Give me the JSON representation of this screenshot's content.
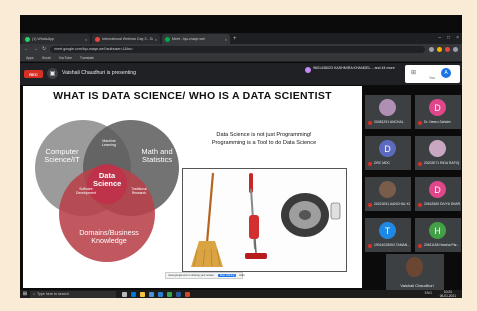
{
  "browser": {
    "tabs": [
      {
        "label": "(1) WhatsApp",
        "icon": "whatsapp-icon",
        "color": "#25d366"
      },
      {
        "label": "International Webinar Day 3 - Sc",
        "icon": "webinar-icon",
        "color": "#e8453c"
      },
      {
        "label": "Meet - fqu-maqe-wei",
        "icon": "meet-icon",
        "color": "#00ac47"
      }
    ],
    "url": "meet.google.com/fqu-maqe-wei?authuser=1&hs=",
    "bookmarks": [
      "Apps",
      "Gmail",
      "YouTube",
      "Translate"
    ]
  },
  "meet": {
    "rec_label": "REC",
    "presenting_text": "Vaishali Chaudhuri is presenting",
    "join_note": "9601436023 KASHMIRA KHANDEL... and 44 more",
    "you_label": "You",
    "you_initial": "A"
  },
  "slide": {
    "title": "WHAT IS DATA SCIENCE/ WHO IS A DATA SCIENTIST",
    "venn": {
      "left": "Computer Science/IT",
      "right": "Math and Statistics",
      "bottom": "Domains/Business Knowledge",
      "center": "Data Science",
      "top_overlap": "Machine Learning",
      "left_overlap": "Software Development",
      "right_overlap": "Traditional Research"
    },
    "note_line1": "Data Science is not just Programming!",
    "note_line2": "Programming is a Tool to do Data Science",
    "share_popup": "meet.google.com is sharing your screen.",
    "share_stop": "Stop sharing",
    "share_hide": "Hide"
  },
  "participants": [
    {
      "name": "20481291 ANCHAL",
      "initial": "",
      "color": "#b08fb5",
      "photo": true
    },
    {
      "name": "Dr. Neeru Sahdev",
      "initial": "D",
      "color": "#e0468a",
      "photo": false
    },
    {
      "name": "DRC MDC",
      "initial": "D",
      "color": "#5c6bc0",
      "photo": false
    },
    {
      "name": "20203071 RIDA RAFIQ",
      "initial": "",
      "color": "#c9a7c0",
      "photo": true
    },
    {
      "name": "20213051 AANCHAL KI...",
      "initial": "",
      "color": "#7a5c4a",
      "photo": true
    },
    {
      "name": "20618360 DIVYA SHAR...",
      "initial": "D",
      "color": "#e0468a",
      "photo": false
    },
    {
      "name": "19014028064 TAMAN...",
      "initial": "T",
      "color": "#1e88e5",
      "photo": false
    },
    {
      "name": "20611188 Harsha Par...",
      "initial": "H",
      "color": "#43a047",
      "photo": false
    }
  ],
  "self": {
    "name": "Vaishali Chaudhuri"
  },
  "taskbar": {
    "search_placeholder": "Type here to search",
    "time": "10:24",
    "date": "06-01-2021",
    "tray": "ENG"
  }
}
